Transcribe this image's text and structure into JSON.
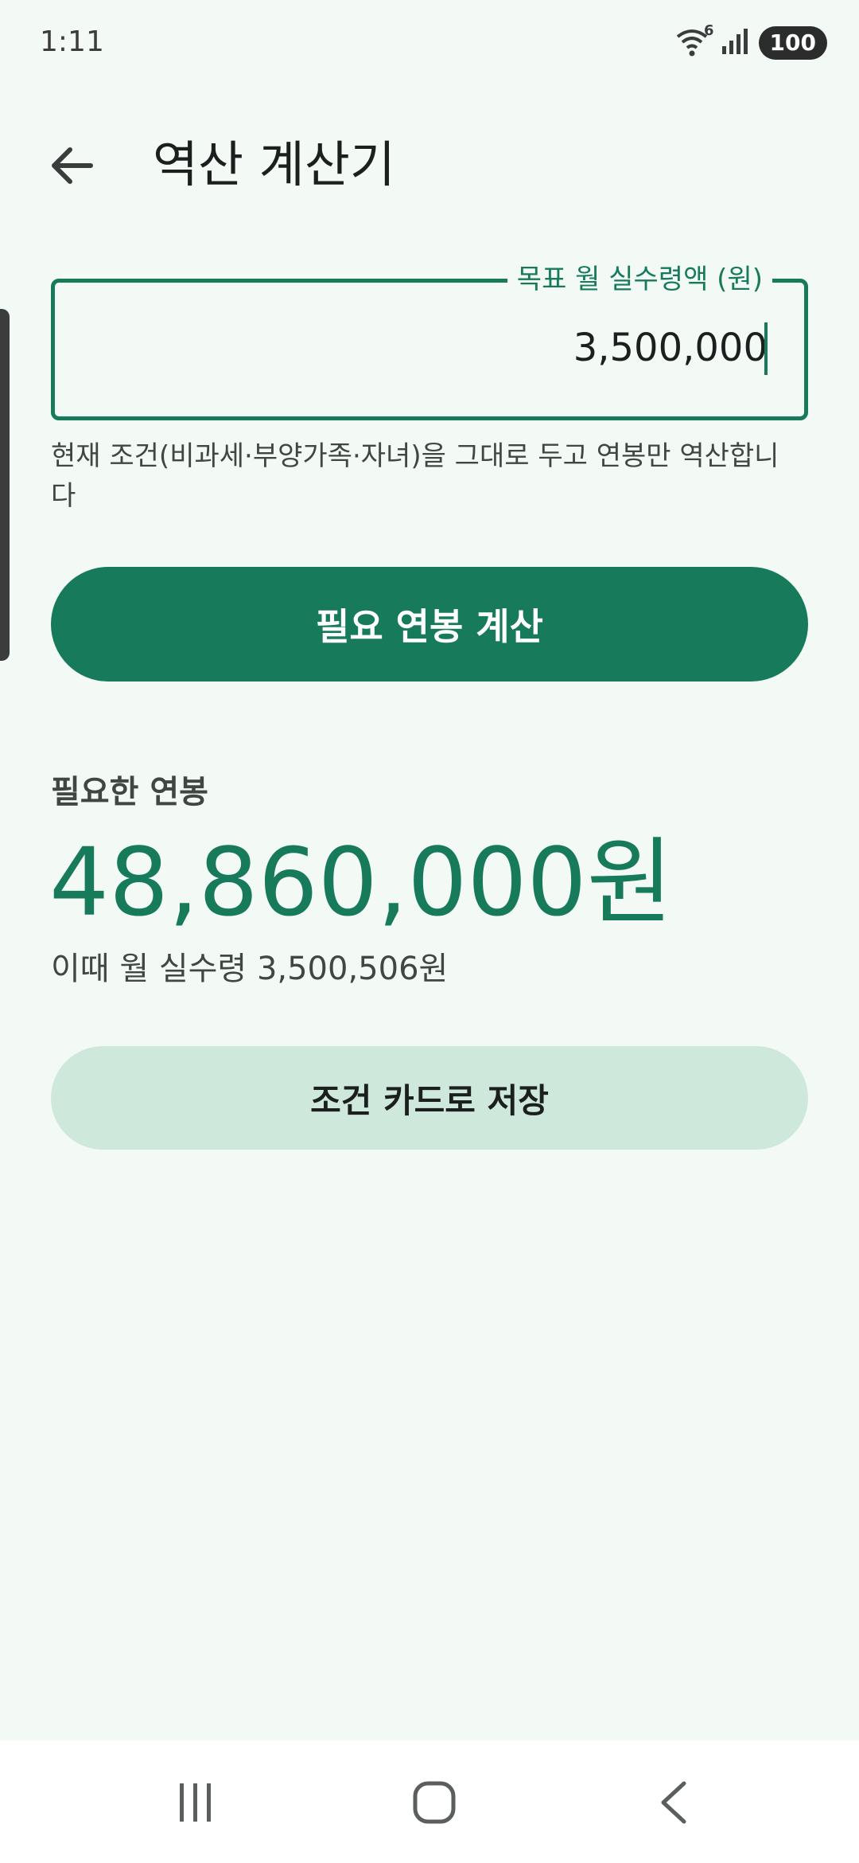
{
  "status": {
    "time": "1:11",
    "battery": "100",
    "wifi_badge": "6"
  },
  "app_bar": {
    "title": "역산 계산기",
    "back_icon": "arrow-left-icon"
  },
  "form": {
    "label": "목표 월 실수령액 (원)",
    "value": "3,500,000",
    "helper": "현재 조건(비과세·부양가족·자녀)을 그대로 두고 연봉만 역산합니다",
    "submit_label": "필요 연봉 계산"
  },
  "result": {
    "label": "필요한 연봉",
    "value": "48,860,000원",
    "sub": "이때 월 실수령 3,500,506원",
    "save_label": "조건 카드로 저장"
  },
  "colors": {
    "primary": "#177a5a",
    "background": "#f3faf6",
    "secondary_button": "#cfe8dc"
  }
}
